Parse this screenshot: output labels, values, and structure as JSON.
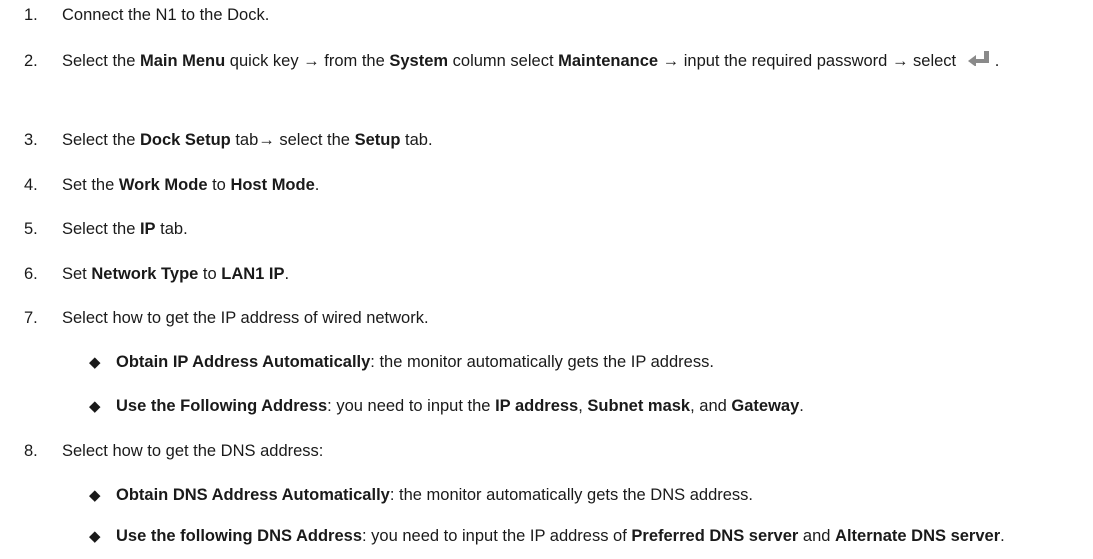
{
  "steps": [
    {
      "num": "1.",
      "parts": [
        {
          "t": "Connect the N1 to the Dock."
        }
      ]
    },
    {
      "num": "2.",
      "parts": [
        {
          "t": "Select the "
        },
        {
          "b": "Main Menu"
        },
        {
          "t": " quick key → from the "
        },
        {
          "b": "System"
        },
        {
          "t": " column select "
        },
        {
          "b": "Maintenance"
        },
        {
          "t": " → input the required password → select "
        },
        {
          "icon": "enter-key-icon"
        },
        {
          "t": "."
        }
      ]
    },
    {
      "num": "3.",
      "parts": [
        {
          "t": "Select the "
        },
        {
          "b": "Dock Setup"
        },
        {
          "t": " tab→ select the "
        },
        {
          "b": "Setup"
        },
        {
          "t": " tab."
        }
      ]
    },
    {
      "num": "4.",
      "parts": [
        {
          "t": "Set the "
        },
        {
          "b": "Work Mode"
        },
        {
          "t": " to "
        },
        {
          "b": "Host Mode"
        },
        {
          "t": "."
        }
      ]
    },
    {
      "num": "5.",
      "parts": [
        {
          "t": "Select the "
        },
        {
          "b": "IP"
        },
        {
          "t": " tab."
        }
      ]
    },
    {
      "num": "6.",
      "parts": [
        {
          "t": "Set "
        },
        {
          "b": "Network Type"
        },
        {
          "t": " to "
        },
        {
          "b": "LAN1 IP"
        },
        {
          "t": "."
        }
      ]
    },
    {
      "num": "7.",
      "parts": [
        {
          "t": "Select how to get the IP address of wired network."
        }
      ]
    },
    {
      "num": "8.",
      "parts": [
        {
          "t": "Select how to get the DNS address:"
        }
      ]
    }
  ],
  "subitems": [
    {
      "bullet": "◆",
      "parts": [
        {
          "b": "Obtain IP Address Automatically"
        },
        {
          "t": ": the monitor automatically gets the IP address."
        }
      ]
    },
    {
      "bullet": "◆",
      "parts": [
        {
          "b": "Use the Following Address"
        },
        {
          "t": ": you need to input the "
        },
        {
          "b": "IP address"
        },
        {
          "t": ", "
        },
        {
          "b": "Subnet mask"
        },
        {
          "t": ", and "
        },
        {
          "b": "Gateway"
        },
        {
          "t": "."
        }
      ]
    },
    {
      "bullet": "◆",
      "parts": [
        {
          "b": "Obtain DNS Address Automatically"
        },
        {
          "t": ": the monitor automatically gets the DNS address."
        }
      ]
    },
    {
      "bullet": "◆",
      "parts": [
        {
          "b": "Use the following DNS Address"
        },
        {
          "t": ": you need to input the IP address of "
        },
        {
          "b": "Preferred DNS server"
        },
        {
          "t": " and "
        },
        {
          "b": "Alternate DNS server"
        },
        {
          "t": "."
        }
      ]
    }
  ]
}
